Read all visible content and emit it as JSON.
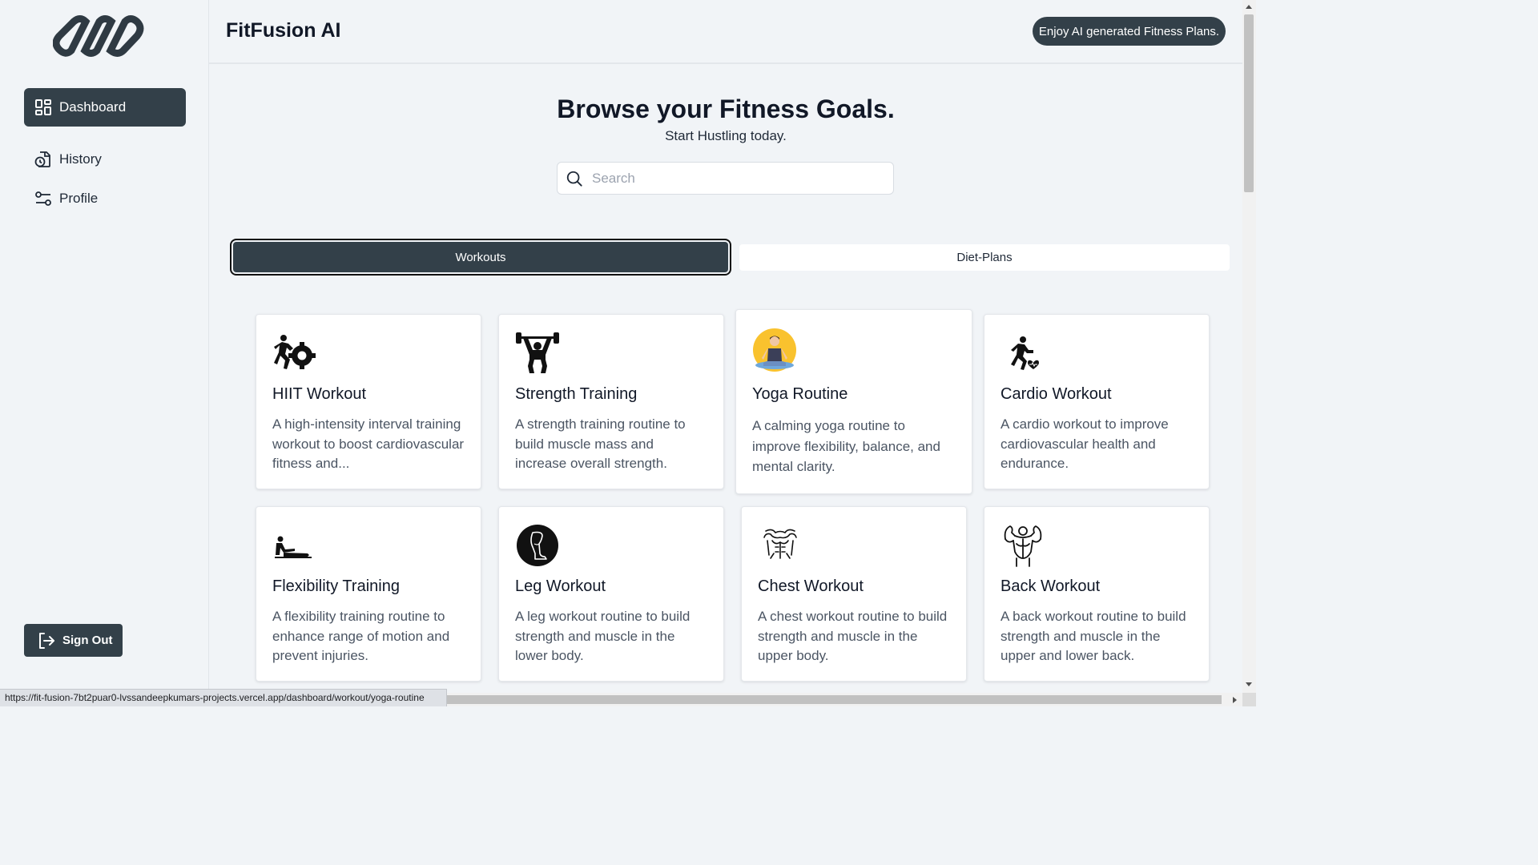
{
  "app": {
    "title": "FitFusion AI",
    "banner": "Enjoy AI generated Fitness Plans."
  },
  "sidebar": {
    "logo_icon": "infinity-chain-logo",
    "items": [
      {
        "label": "Dashboard",
        "icon": "dashboard-grid-icon",
        "active": true
      },
      {
        "label": "History",
        "icon": "history-clock-icon",
        "active": false
      },
      {
        "label": "Profile",
        "icon": "sliders-icon",
        "active": false
      }
    ],
    "sign_out": "Sign Out"
  },
  "main": {
    "title": "Browse your Fitness Goals.",
    "subtitle": "Start Hustling today.",
    "search": {
      "placeholder": "Search",
      "value": ""
    },
    "tabs": [
      {
        "label": "Workouts",
        "active": true
      },
      {
        "label": "Diet-Plans",
        "active": false
      }
    ],
    "cards": [
      {
        "title": "HIIT Workout",
        "desc": "A high-intensity interval training workout to boost cardiovascular fitness and...",
        "icon": "hiit-runner-gear-icon"
      },
      {
        "title": "Strength Training",
        "desc": "A strength training routine to build muscle mass and increase overall strength.",
        "icon": "weightlifter-icon"
      },
      {
        "title": "Yoga Routine",
        "desc": "A calming yoga routine to improve flexibility, balance, and mental clarity.",
        "icon": "yoga-meditation-icon"
      },
      {
        "title": "Cardio Workout",
        "desc": "A cardio workout to improve cardiovascular health and endurance.",
        "icon": "runner-heart-icon"
      },
      {
        "title": "Flexibility Training",
        "desc": "A flexibility training routine to enhance range of motion and prevent injuries.",
        "icon": "stretching-person-icon"
      },
      {
        "title": "Leg Workout",
        "desc": "A leg workout routine to build strength and muscle in the lower body.",
        "icon": "leg-icon"
      },
      {
        "title": "Chest Workout",
        "desc": "A chest workout routine to build strength and muscle in the upper body.",
        "icon": "chest-torso-icon"
      },
      {
        "title": "Back Workout",
        "desc": "A back workout routine to build strength and muscle in the upper and lower back.",
        "icon": "back-muscles-icon"
      }
    ]
  },
  "status_url": "https://fit-fusion-7bt2puar0-lvssandeepkumars-projects.vercel.app/dashboard/workout/yoga-routine",
  "colors": {
    "accent": "#334049",
    "background": "#f1f4f7",
    "card": "#ffffff"
  }
}
